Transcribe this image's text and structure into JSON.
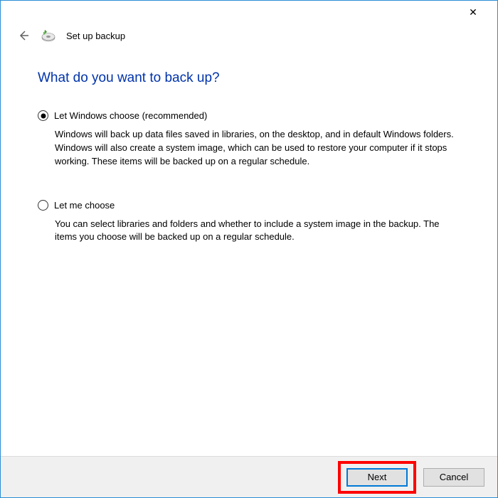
{
  "titlebar": {
    "close_label": "✕"
  },
  "header": {
    "title": "Set up backup"
  },
  "main": {
    "heading": "What do you want to back up?",
    "options": [
      {
        "label": "Let Windows choose (recommended)",
        "description": "Windows will back up data files saved in libraries, on the desktop, and in default Windows folders. Windows will also create a system image, which can be used to restore your computer if it stops working. These items will be backed up on a regular schedule.",
        "selected": true
      },
      {
        "label": "Let me choose",
        "description": "You can select libraries and folders and whether to include a system image in the backup. The items you choose will be backed up on a regular schedule.",
        "selected": false
      }
    ]
  },
  "footer": {
    "next_label": "Next",
    "cancel_label": "Cancel"
  }
}
